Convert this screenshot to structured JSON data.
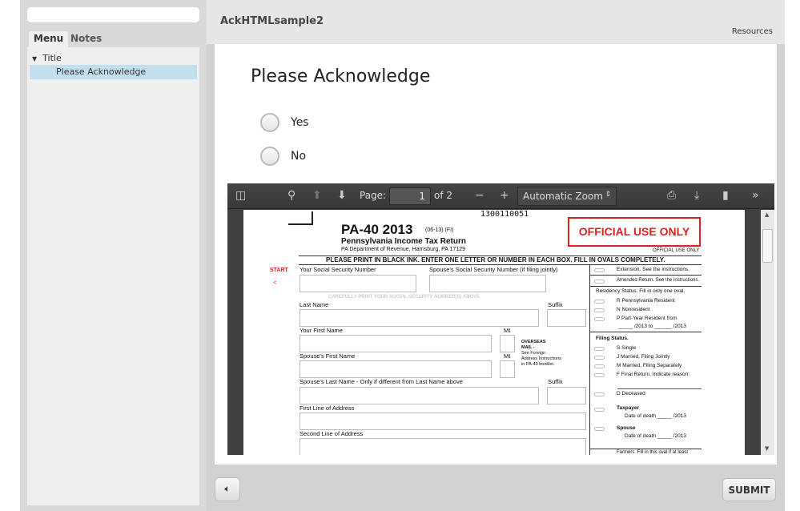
{
  "sidebar": {
    "search_placeholder": "",
    "tabs": [
      "Menu",
      "Notes"
    ],
    "tree": {
      "parent": "Title",
      "child": "Please Acknowledge"
    }
  },
  "header": {
    "title": "AckHTMLsample2",
    "resources": "Resources"
  },
  "question": {
    "title": "Please Acknowledge",
    "options": [
      "Yes",
      "No"
    ]
  },
  "pdf_toolbar": {
    "page_label": "Page:",
    "page_value": "1",
    "page_total": "of 2",
    "zoom": "Automatic Zoom"
  },
  "form": {
    "barcode": "1300110051",
    "form_id": "PA-40 2013",
    "rev": "(06-13) (FI)",
    "subtitle": "Pennsylvania Income Tax Return",
    "dept": "PA Department of Revenue, Harrisburg, PA 17129",
    "official": "OFFICIAL USE ONLY",
    "official_small": "OFFICIAL USE ONLY",
    "instructions": "PLEASE PRINT IN BLACK INK. ENTER ONE LETTER OR NUMBER IN EACH BOX. FILL IN OVALS COMPLETELY.",
    "start": "START",
    "start_arrow": "<",
    "labels": [
      "Your Social Security Number",
      "Spouse's Social Security Number (if filing jointly)",
      "CAREFULLY PRINT YOUR SOCIAL SECURITY NUMBER(S) ABOVE",
      "Last Name",
      "Suffix",
      "Your First Name",
      "MI",
      "Spouse's First Name",
      "MI",
      "Spouse's Last Name - Only if different from Last Name above",
      "Suffix",
      "First Line of Address",
      "Second Line of Address"
    ],
    "overseas": [
      "OVERSEAS",
      "MAIL -",
      "See Foreign",
      "Address Instructions",
      "in PA-40 booklet."
    ],
    "right": [
      "Extension. See the instructions.",
      "Amended Return. See the instructions.",
      "Residency Status. Fill in only one oval.",
      "R  Pennsylvania Resident",
      "N  Nonresident",
      "P  Part-Year Resident from",
      "_____ /2013 to ______ /2013",
      "Filing Status.",
      "S  Single",
      "J  Married, Filing Jointly",
      "M  Married, Filing Separately",
      "F  Final Return. Indicate reason:",
      "D  Deceased",
      "Taxpayer",
      "Date of death _____ /2013",
      "Spouse",
      "Date of death _____ /2013",
      "Farmers. Fill in this oval if at least"
    ]
  },
  "footer": {
    "submit": "SUBMIT"
  }
}
